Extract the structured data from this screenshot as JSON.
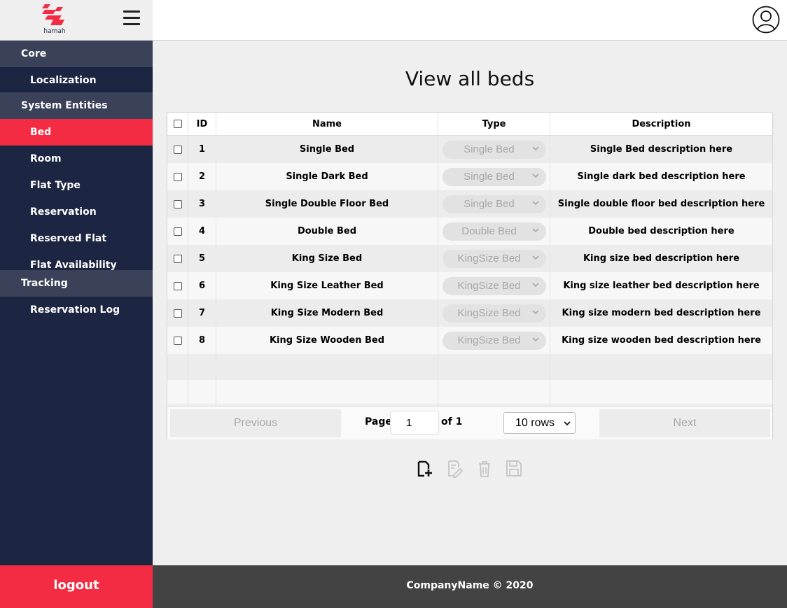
{
  "brand": {
    "logo_text": "hamah",
    "accent": "#f42c43",
    "sidebar_bg": "#1c2541"
  },
  "sidebar": {
    "groups": [
      {
        "label": "Core"
      },
      {
        "label": "System Entities"
      },
      {
        "label": "Tracking"
      }
    ],
    "items": [
      {
        "label": "Localization"
      },
      {
        "label": "Bed"
      },
      {
        "label": "Room"
      },
      {
        "label": "Flat Type"
      },
      {
        "label": "Reservation"
      },
      {
        "label": "Reserved Flat"
      },
      {
        "label": "Flat Availability"
      },
      {
        "label": "Reservation Log"
      }
    ],
    "logout_label": "logout"
  },
  "header": {
    "menu_icon": "hamburger-icon",
    "user_icon": "user-icon"
  },
  "page": {
    "title": "View all beds"
  },
  "table": {
    "columns": [
      "ID",
      "Name",
      "Type",
      "Description"
    ],
    "rows": [
      {
        "id": "1",
        "name": "Single Bed",
        "type": "Single Bed",
        "description": "Single Bed description here"
      },
      {
        "id": "2",
        "name": "Single Dark Bed",
        "type": "Single Bed",
        "description": "Single dark bed description here"
      },
      {
        "id": "3",
        "name": "Single Double Floor Bed",
        "type": "Single Bed",
        "description": "Single double floor bed description here"
      },
      {
        "id": "4",
        "name": "Double Bed",
        "type": "Double Bed",
        "description": "Double bed description here"
      },
      {
        "id": "5",
        "name": "King Size Bed",
        "type": "KingSize Bed",
        "description": "King size bed description here"
      },
      {
        "id": "6",
        "name": "King Size Leather Bed",
        "type": "KingSize Bed",
        "description": "King size leather bed description here"
      },
      {
        "id": "7",
        "name": "King Size Modern Bed",
        "type": "KingSize Bed",
        "description": "King size modern bed description here"
      },
      {
        "id": "8",
        "name": "King Size Wooden Bed",
        "type": "KingSize Bed",
        "description": "King size wooden bed description here"
      }
    ]
  },
  "pagination": {
    "previous_label": "Previous",
    "page_label": "Page",
    "page_value": "1",
    "of_label": "of 1",
    "rows_option": "10 rows",
    "next_label": "Next"
  },
  "actions": [
    {
      "icon": "add-file-icon"
    },
    {
      "icon": "edit-icon"
    },
    {
      "icon": "delete-icon"
    },
    {
      "icon": "save-icon"
    }
  ],
  "footer": {
    "text": "CompanyName © 2020"
  }
}
